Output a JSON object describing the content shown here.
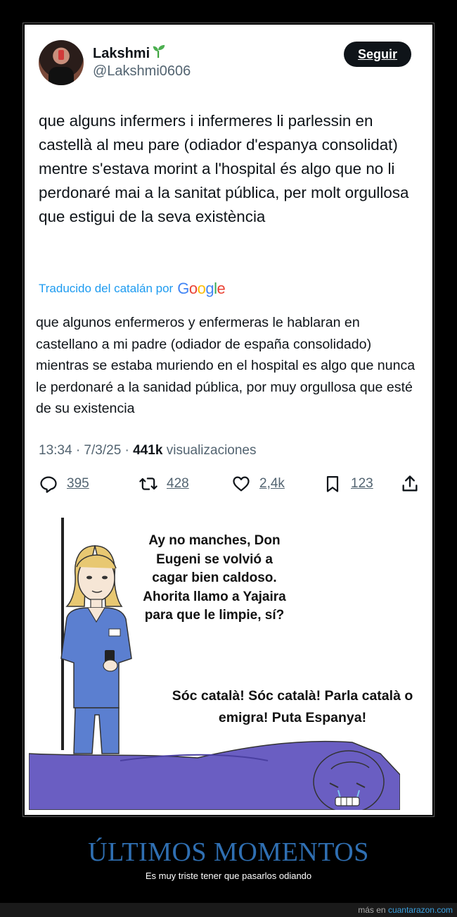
{
  "tweet": {
    "author_name": "Lakshmi",
    "author_handle": "@Lakshmi0606",
    "follow_label": "Seguir",
    "text": "que alguns infermers i infermeres li parlessin en castellà al meu pare (odiador d'espanya consolidat) mentre s'estava morint a l'hospital és algo que no li perdonaré mai a la sanitat pública, per molt orgullosa que estigui de la seva existència",
    "translated_by_label": "Traducido del catalán por",
    "google_logo_text": "Google",
    "translated_text": "que algunos enfermeros y enfermeras le hablaran en castellano a mi padre (odiador de españa consolidado) mientras se estaba muriendo en el hospital es algo que nunca le perdonaré a la sanidad pública, por muy orgullosa que esté de su existencia",
    "time_date": "13:34 · 7/3/25 · ",
    "views_count": "441k",
    "views_label": " visualizaciones",
    "actions": {
      "replies": "395",
      "retweets": "428",
      "likes": "2,4k",
      "bookmarks": "123"
    }
  },
  "meme": {
    "nurse_speech": "Ay no manches, Don Eugeni se volvió a cagar bien caldoso. Ahorita llamo a Yajaira para que le limpie, sí?",
    "patient_speech": "Sóc català! Sóc català! Parla català o emigra! Puta Espanya!"
  },
  "footer": {
    "title": "ÚLTIMOS MOMENTOS",
    "subtitle": "Es muy triste tener que pasarlos odiando",
    "more_prefix": "más en ",
    "site": "cuantarazon.com"
  },
  "colors": {
    "accent_blue": "#1d9bf0",
    "footer_title": "#2f6fb2",
    "scrubs": "#5b7fd0",
    "bed_sheet": "#6a5ec2"
  }
}
